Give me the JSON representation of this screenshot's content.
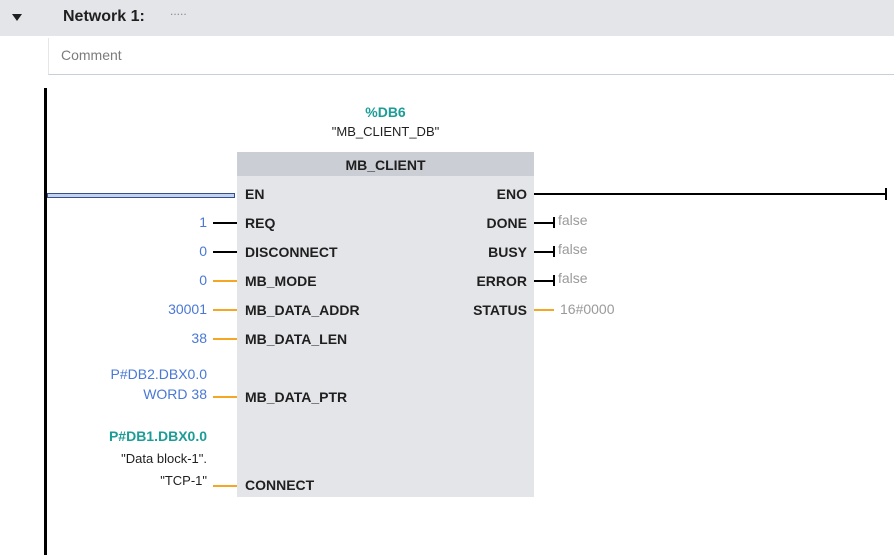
{
  "network": {
    "title": "Network 1:",
    "description": ".....",
    "comment_placeholder": "Comment"
  },
  "block": {
    "db_address": "%DB6",
    "db_name": "\"MB_CLIENT_DB\"",
    "name": "MB_CLIENT",
    "inputs": {
      "en": "EN",
      "req": "REQ",
      "disconnect": "DISCONNECT",
      "mb_mode": "MB_MODE",
      "mb_data_addr": "MB_DATA_ADDR",
      "mb_data_len": "MB_DATA_LEN",
      "mb_data_ptr": "MB_DATA_PTR",
      "connect": "CONNECT"
    },
    "outputs": {
      "eno": "ENO",
      "done": "DONE",
      "busy": "BUSY",
      "error": "ERROR",
      "status": "STATUS"
    }
  },
  "input_values": {
    "req": "1",
    "disconnect": "0",
    "mb_mode": "0",
    "mb_data_addr": "30001",
    "mb_data_len": "38",
    "mb_data_ptr_line1": "P#DB2.DBX0.0",
    "mb_data_ptr_line2": "WORD 38",
    "connect_address": "P#DB1.DBX0.0",
    "connect_line1": "\"Data block-1\".",
    "connect_line2": "\"TCP-1\""
  },
  "output_values": {
    "done": "false",
    "busy": "false",
    "error": "false",
    "status": "16#0000"
  },
  "colors": {
    "constant": "#4a78d6",
    "address": "#1b9c97",
    "wire_bool": "#000000",
    "wire_data": "#f5a623",
    "status_value": "#9a9a9a"
  }
}
